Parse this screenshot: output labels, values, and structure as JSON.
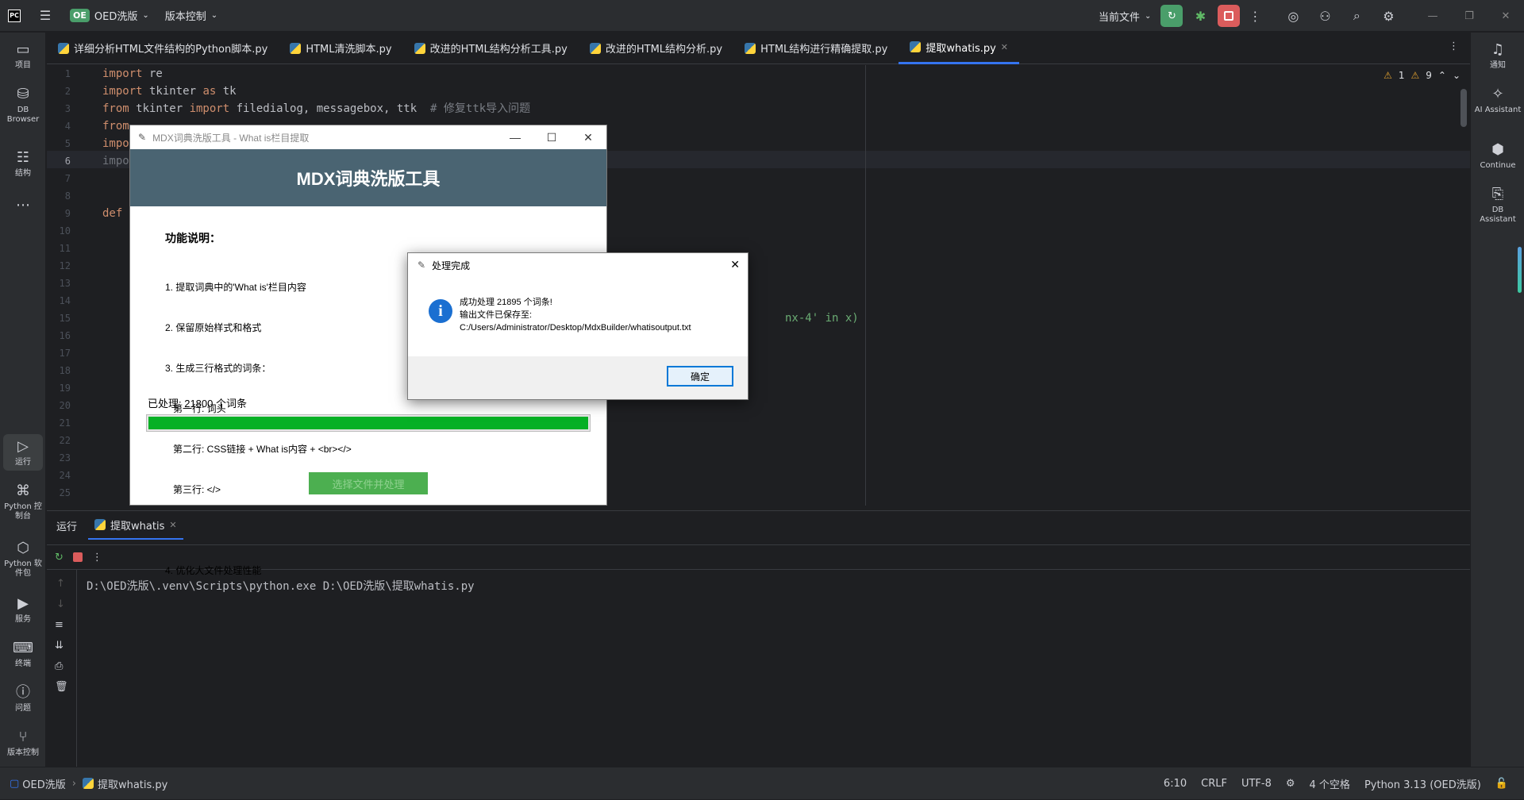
{
  "titlebar": {
    "project_badge": "OE",
    "project": "OED洗版",
    "vcs": "版本控制",
    "current_file": "当前文件"
  },
  "leftbar": [
    {
      "label": "项目",
      "icon": "folder-icon"
    },
    {
      "label": "DB Browser",
      "icon": "database-icon"
    },
    {
      "label": "结构",
      "icon": "structure-icon"
    },
    {
      "label": "运行",
      "icon": "run-icon"
    },
    {
      "label": "Python 控制台",
      "icon": "python-console-icon"
    },
    {
      "label": "Python 软件包",
      "icon": "python-packages-icon"
    },
    {
      "label": "服务",
      "icon": "services-icon"
    },
    {
      "label": "终端",
      "icon": "terminal-icon"
    },
    {
      "label": "问题",
      "icon": "problems-icon"
    },
    {
      "label": "版本控制",
      "icon": "vcs-icon"
    }
  ],
  "rightbar": [
    {
      "label": "通知",
      "icon": "bell-icon"
    },
    {
      "label": "AI Assistant",
      "icon": "ai-assistant-icon"
    },
    {
      "label": "Continue",
      "icon": "continue-icon"
    },
    {
      "label": "DB Assistant",
      "icon": "db-assistant-icon"
    }
  ],
  "tabs": [
    {
      "label": "详细分析HTML文件结构的Python脚本.py"
    },
    {
      "label": "HTML清洗脚本.py"
    },
    {
      "label": "改进的HTML结构分析工具.py"
    },
    {
      "label": "改进的HTML结构分析.py"
    },
    {
      "label": "HTML结构进行精确提取.py"
    },
    {
      "label": "提取whatis.py"
    }
  ],
  "inspections": {
    "warnings": "1",
    "weak": "9"
  },
  "code": {
    "line_numbers": [
      "1",
      "2",
      "3",
      "4",
      "5",
      "6",
      "7",
      "8",
      "9",
      "10",
      "11",
      "12",
      "13",
      "14",
      "15",
      "16",
      "17",
      "18",
      "19",
      "20",
      "21",
      "22",
      "23",
      "24",
      "25"
    ],
    "l1_kw": "import",
    "l1_rest": " re",
    "l2_kw": "import",
    "l2_mid": " tkinter ",
    "l2_kw2": "as",
    "l2_rest": " tk",
    "l3_kw": "from",
    "l3_mid": " tkinter ",
    "l3_kw2": "import",
    "l3_rest": " filedialog, messagebox, ttk  ",
    "l3_cm": "# 修复ttk导入问题",
    "l4": "from",
    "l5": "impo",
    "l6": "impo",
    "l9": "def",
    "l15_frag": "nx-4' in x)"
  },
  "run": {
    "label": "运行",
    "tab": "提取whatis",
    "output": "D:\\OED洗版\\.venv\\Scripts\\python.exe D:\\OED洗版\\提取whatis.py"
  },
  "status": {
    "project": "OED洗版",
    "file": "提取whatis.py",
    "position": "6:10",
    "line_ending": "CRLF",
    "encoding": "UTF-8",
    "indent": "4 个空格",
    "interpreter": "Python 3.13 (OED洗版)"
  },
  "tkwindow": {
    "title": "MDX词典洗版工具 - What is栏目提取",
    "banner": "MDX词典洗版工具",
    "features_title": "功能说明：",
    "features": [
      "1. 提取词典中的'What is'栏目内容",
      "2. 保留原始样式和格式",
      "3. 生成三行格式的词条：",
      "   第一行: 词头",
      "   第二行: CSS链接 + What is内容 + <br></>",
      "   第三行: </>",
      "",
      "4. 优化大文件处理性能"
    ],
    "processed": "已处理: 21800 个词条",
    "progress_percent": 100,
    "button": "选择文件并处理"
  },
  "dialog": {
    "title": "处理完成",
    "line1": "成功处理 21895 个词条!",
    "line2": "输出文件已保存至:",
    "line3": "C:/Users/Administrator/Desktop/MdxBuilder/whatisoutput.txt",
    "ok": "确定"
  }
}
